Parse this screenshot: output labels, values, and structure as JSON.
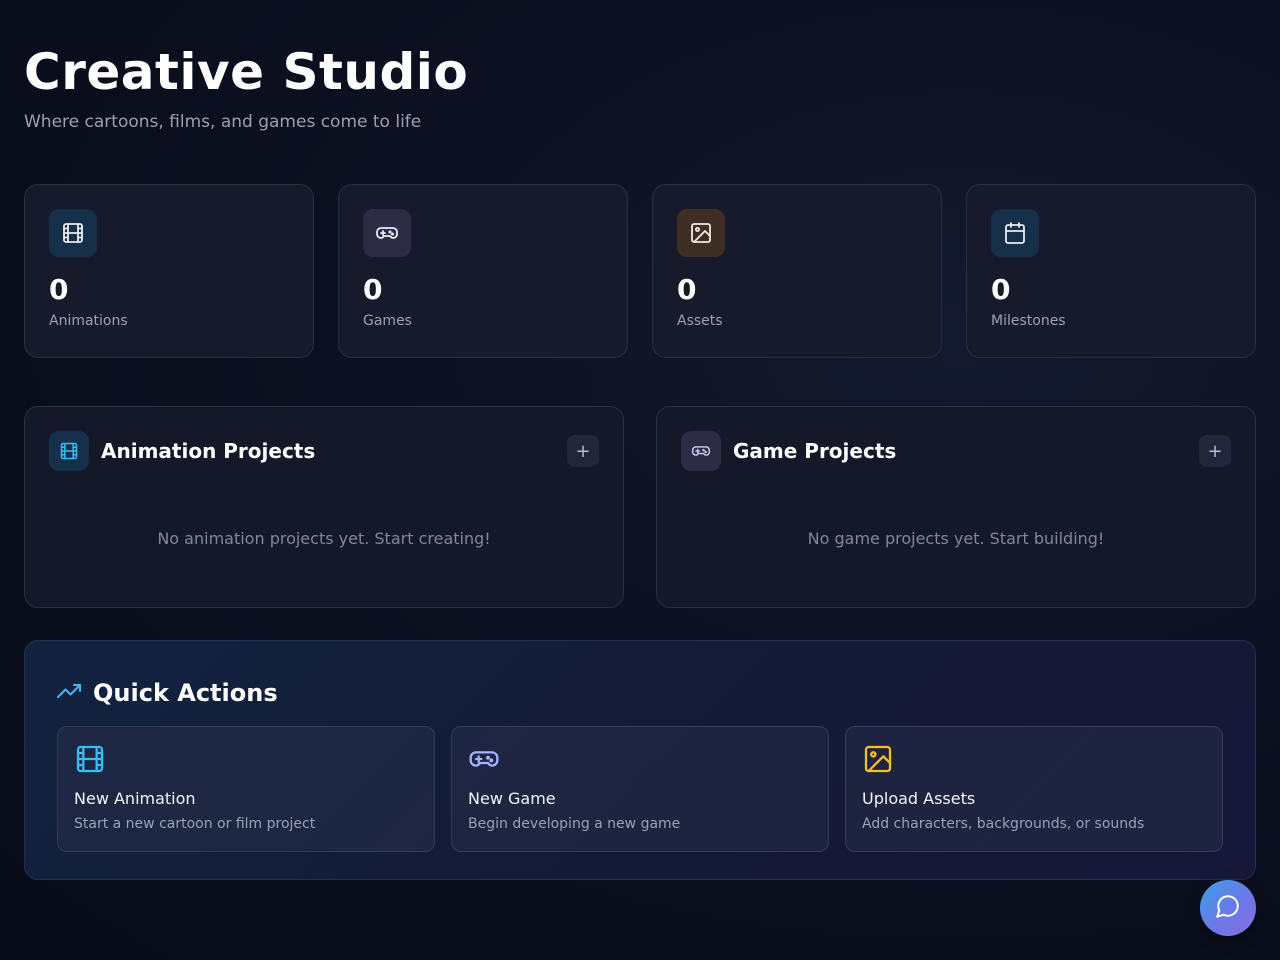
{
  "header": {
    "title": "Creative Studio",
    "subtitle": "Where cartoons, films, and games come to life"
  },
  "stats": [
    {
      "icon": "film-icon",
      "value": "0",
      "label": "Animations",
      "color": "#38bdf8"
    },
    {
      "icon": "gamepad-icon",
      "value": "0",
      "label": "Games",
      "color": "#c4c8f0"
    },
    {
      "icon": "image-icon",
      "value": "0",
      "label": "Assets",
      "color": "#ffffff"
    },
    {
      "icon": "calendar-icon",
      "value": "0",
      "label": "Milestones",
      "color": "#ffffff"
    }
  ],
  "projects": {
    "animation": {
      "icon": "film-icon",
      "title": "Animation Projects",
      "add_label": "+",
      "empty": "No animation projects yet. Start creating!"
    },
    "game": {
      "icon": "gamepad-icon",
      "title": "Game Projects",
      "add_label": "+",
      "empty": "No game projects yet. Start building!"
    }
  },
  "quick_actions": {
    "icon": "trending-up-icon",
    "title": "Quick Actions",
    "items": [
      {
        "icon": "film-icon",
        "title": "New Animation",
        "description": "Start a new cartoon or film project",
        "color": "#38bdf8"
      },
      {
        "icon": "gamepad-icon",
        "title": "New Game",
        "description": "Begin developing a new game",
        "color": "#a5b4fc"
      },
      {
        "icon": "image-icon",
        "title": "Upload Assets",
        "description": "Add characters, backgrounds, or sounds",
        "color": "#fbbf24"
      }
    ]
  },
  "chat": {
    "icon": "chat-bubble-icon"
  }
}
